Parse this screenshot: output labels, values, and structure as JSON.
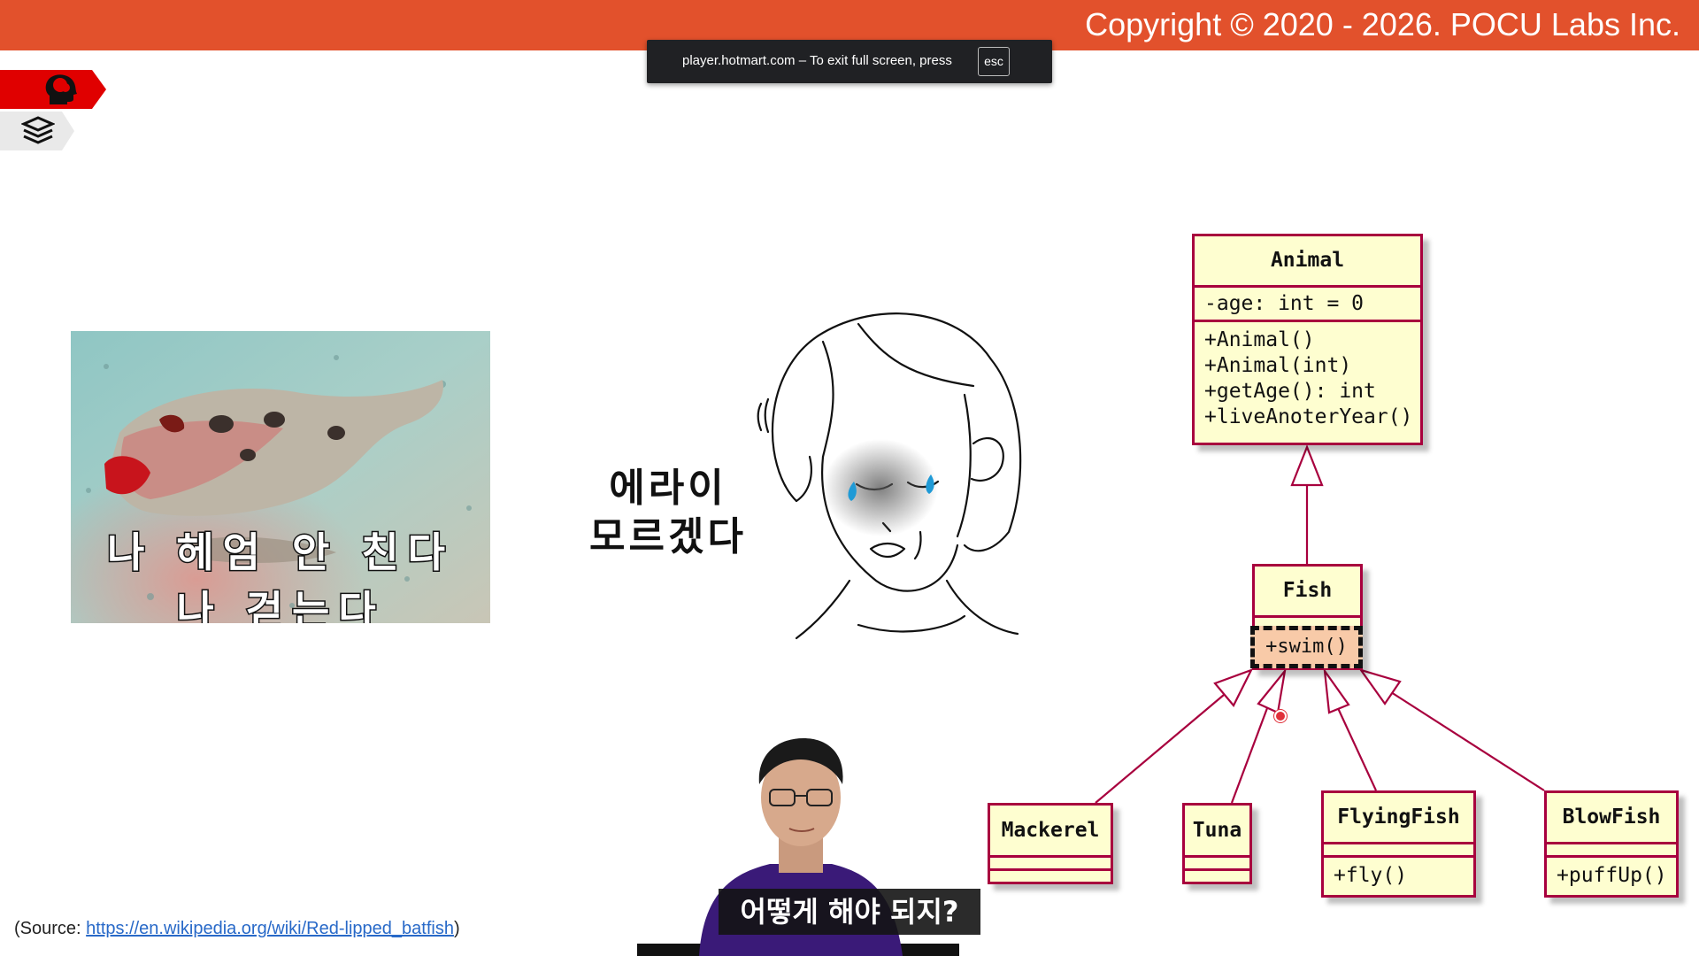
{
  "header": {
    "copyright": "Copyright © 2020 - 2026. POCU Labs Inc."
  },
  "toast": {
    "message": "player.hotmart.com – To exit full screen, press",
    "key": "esc"
  },
  "nav_tabs": [
    {
      "icon": "brain-head-icon",
      "color": "#e00000"
    },
    {
      "icon": "stacked-layers-icon",
      "color": "#f0f0f0"
    }
  ],
  "photo": {
    "caption_line1": "나 헤엄 안 친다",
    "caption_line2": "나 걷는다"
  },
  "speech": {
    "line1": "에라이",
    "line2": "모르겠다"
  },
  "uml": {
    "classes": [
      {
        "name": "Animal",
        "attributes": [
          "-age: int = 0"
        ],
        "methods": [
          "+Animal()",
          "+Animal(int)",
          "+getAge(): int",
          "+liveAnoterYear()"
        ]
      },
      {
        "name": "Fish",
        "attributes": [],
        "methods": [
          "+swim()"
        ]
      },
      {
        "name": "Mackerel",
        "attributes": [],
        "methods": []
      },
      {
        "name": "Tuna",
        "attributes": [],
        "methods": []
      },
      {
        "name": "FlyingFish",
        "attributes": [],
        "methods": [
          "+fly()"
        ]
      },
      {
        "name": "BlowFish",
        "attributes": [],
        "methods": [
          "+puffUp()"
        ]
      }
    ],
    "border_color": "#a8003e",
    "fill_color": "#fefed0",
    "highlight_color": "#f8caa8"
  },
  "source": {
    "prefix": "(Source: ",
    "link": "https://en.wikipedia.org/wiki/Red-lipped_batfish",
    "suffix": ")"
  },
  "subtitle": "어떻게 해야 되지?"
}
